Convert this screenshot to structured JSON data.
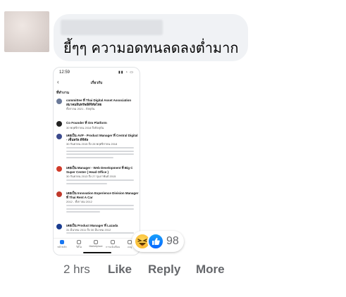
{
  "comment": {
    "text": "ยี้ๆๆ ความอดทนลดลงต่ำมาก",
    "reaction_count": "98",
    "time": "2 hrs",
    "actions": {
      "like": "Like",
      "reply": "Reply",
      "more": "More"
    }
  },
  "attachment": {
    "status_time": "12:59",
    "nav_title": "เกี่ยวกับ",
    "section": "ที่ทำงาน",
    "entries": [
      {
        "title": "committee ที่ Thai Digital Asset Association สมาคมสินทรัพย์ดิจิทัลไทย",
        "sub": "ทั้งกาลม 2021 - ปัจจุบัน",
        "icon_color": "#6b7a99"
      },
      {
        "title": "Co Founder ที่ Om Platform",
        "sub": "30 พฤศจิกายน 2018 ถึงปัจจุบัน",
        "icon_color": "#222222"
      },
      {
        "title": "เคยเป็น AVP - Product Manager ที่ Central Digital - เซ็นทรัล ดิจิทัล",
        "sub": "30 กันยายน 2015 ถึง 28 พฤศจิกายน 2018",
        "icon_color": "#3b4a8c"
      },
      {
        "title": "เคยเป็น Manager - Web Development ที่ Big C Super Center ( Head Office )",
        "sub": "30 กันยายน 2013 ถึง 27 กุมภาพันธ์ 2015",
        "icon_color": "#d13b2a"
      },
      {
        "title": "เคยเป็น Innovation Experience Division Manager ที่ Thai Rent A Car",
        "sub": "2012 - ทั้งกาลม 2012",
        "icon_color": "#c0392b"
      },
      {
        "title": "เคยเป็น Product Manager ที่ Lazada",
        "sub": "31 มีนาคม 2011 ถึง 30 มีนาคม 2012",
        "icon_color": "#1a3c8f"
      }
    ],
    "tabs": [
      "หน้าหลัก",
      "วิดีโอ",
      "Marketplace",
      "การแจ้งเตือน",
      "เมนู"
    ]
  },
  "colors": {
    "bubble": "#f0f2f5",
    "meta": "#65676b",
    "like_blue": "#0866ff",
    "haha_yellow": "#f7b125"
  }
}
